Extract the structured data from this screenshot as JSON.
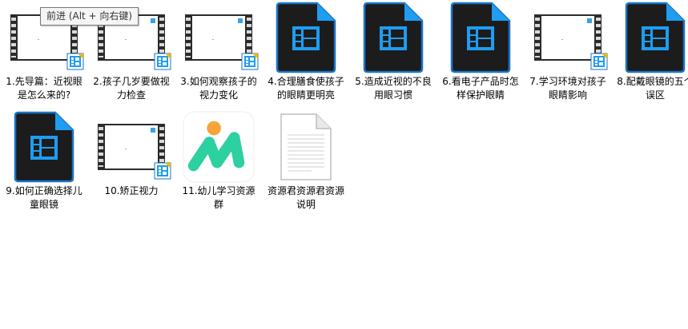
{
  "tooltip": "前进 (Alt + 向右键)",
  "files": [
    {
      "name": "1.先导篇：近视眼是怎么来的?",
      "type": "film"
    },
    {
      "name": "2.孩子几岁要做视力检查",
      "type": "film"
    },
    {
      "name": "3.如何观察孩子的视力变化",
      "type": "film"
    },
    {
      "name": "4.合理膳食使孩子的眼睛更明亮",
      "type": "video"
    },
    {
      "name": "5.造成近视的不良用眼习惯",
      "type": "video"
    },
    {
      "name": "6.看电子产品时怎样保护眼睛",
      "type": "video"
    },
    {
      "name": "7.学习环境对孩子眼睛影响",
      "type": "film"
    },
    {
      "name": "8.配戴眼镜的五个误区",
      "type": "video"
    },
    {
      "name": "9.如何正确选择儿童眼镜",
      "type": "video"
    },
    {
      "name": "10.矫正视力",
      "type": "film"
    },
    {
      "name": "11.幼儿学习资源群",
      "type": "app"
    },
    {
      "name": "资源君资源君资源说明",
      "type": "text"
    }
  ],
  "colors": {
    "video_icon_bg": "#1c1c1c",
    "video_icon_border": "#1a73c9",
    "video_glyph": "#1e9df1",
    "app_orange": "#f5a43a",
    "app_green": "#2dd0a0"
  }
}
